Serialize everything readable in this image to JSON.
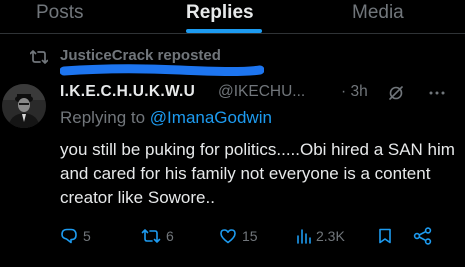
{
  "tabs": {
    "posts": "Posts",
    "replies": "Replies",
    "media": "Media",
    "active": "Replies"
  },
  "repost_context": {
    "text": "JusticeCrack reposted"
  },
  "tweet": {
    "author_name": "I.K.E.C.H.U.K.W.U",
    "author_handle": "@IKECHU...",
    "time": "· 3h",
    "replying_label": "Replying to",
    "replying_handle": "@ImanaGodwin",
    "body": "you still be puking for politics.....Obi hired a SAN him and cared for his family not everyone is a content creator like Sowore..",
    "stats": {
      "replies": "5",
      "reposts": "6",
      "likes": "15",
      "views": "2.3K"
    }
  },
  "colors": {
    "background": "#000000",
    "text_primary": "#e7e9ea",
    "text_secondary": "#71767b",
    "accent": "#1d9bf0",
    "divider": "#2f3336"
  },
  "icons": {
    "repost_context": "repost-icon",
    "grok": "grok-icon",
    "more": "more-icon",
    "reply": "reply-icon",
    "repost": "repost-icon",
    "like": "heart-icon",
    "views": "views-icon",
    "bookmark": "bookmark-icon",
    "share": "share-icon"
  }
}
